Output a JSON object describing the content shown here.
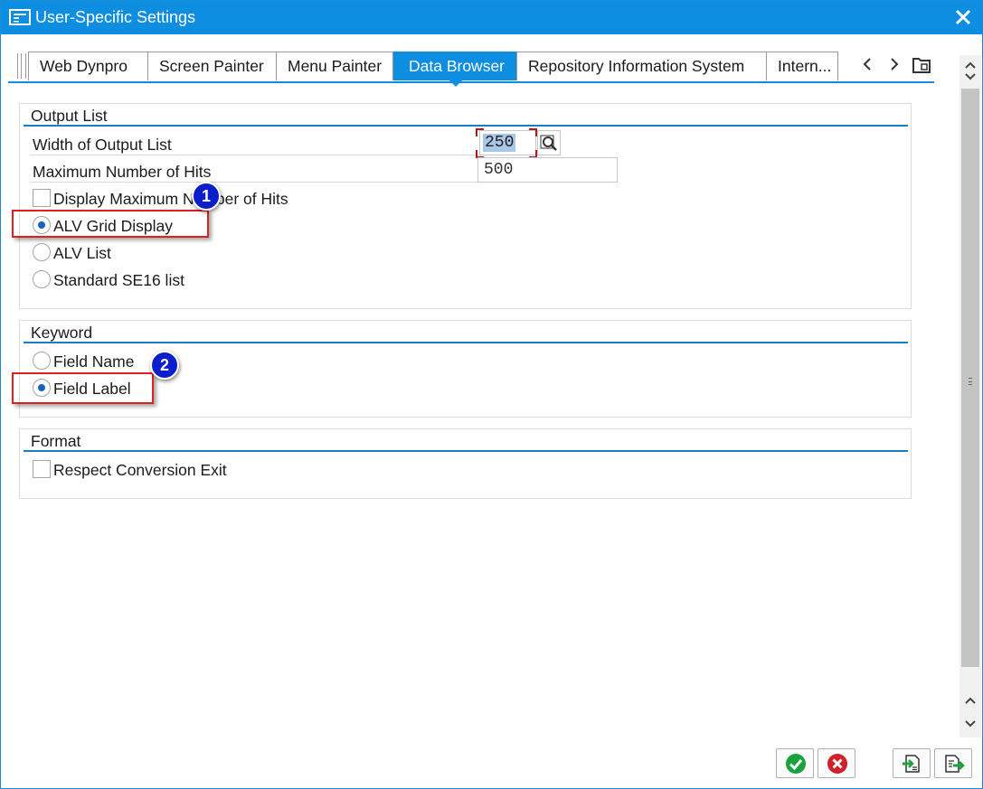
{
  "window": {
    "title": "User-Specific Settings"
  },
  "tabs": [
    {
      "label": "Web Dynpro",
      "active": false
    },
    {
      "label": "Screen Painter",
      "active": false
    },
    {
      "label": "Menu Painter",
      "active": false
    },
    {
      "label": "Data Browser",
      "active": true
    },
    {
      "label": "Repository Information System",
      "active": false
    },
    {
      "label": "Intern...",
      "active": false
    }
  ],
  "output_list": {
    "title": "Output List",
    "width_label": "Width of Output List",
    "width_value": "250",
    "max_hits_label": "Maximum Number of Hits",
    "max_hits_value": "500",
    "display_max_label": "Display Maximum Number of Hits",
    "display_max_checked": false,
    "options": [
      {
        "label": "ALV Grid Display",
        "selected": true
      },
      {
        "label": "ALV List",
        "selected": false
      },
      {
        "label": "Standard SE16 list",
        "selected": false
      }
    ]
  },
  "keyword": {
    "title": "Keyword",
    "options": [
      {
        "label": "Field Name",
        "selected": false
      },
      {
        "label": "Field Label",
        "selected": true
      }
    ]
  },
  "format": {
    "title": "Format",
    "respect_conversion_label": "Respect Conversion Exit",
    "respect_conversion_checked": false
  },
  "annotations": [
    {
      "number": "1",
      "target": "ALV Grid Display"
    },
    {
      "number": "2",
      "target": "Field Label"
    }
  ],
  "icons": {
    "window": "window-settings-icon",
    "close": "close-icon",
    "tab_prev": "chevron-left-icon",
    "tab_next": "chevron-right-icon",
    "tab_list": "tab-list-icon",
    "value_help": "search-help-icon",
    "confirm": "checkmark-icon",
    "cancel": "cancel-icon",
    "copy": "copy-settings-icon",
    "export": "export-settings-icon"
  },
  "colors": {
    "title_bar": "#0d8ee0",
    "active_tab": "#0d8ee0",
    "highlight_box": "#e02020",
    "badge": "#0a1ecc",
    "confirm": "#1aa33a",
    "cancel": "#d0202a"
  }
}
